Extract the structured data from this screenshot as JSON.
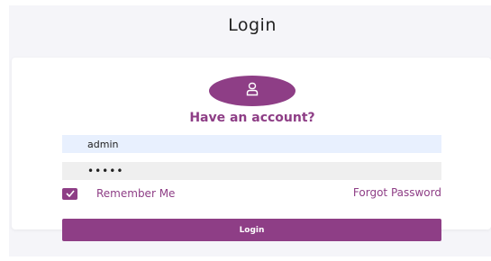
{
  "page": {
    "title": "Login"
  },
  "card": {
    "avatar_icon": "user-icon",
    "heading": "Have an account?",
    "username_value": "admin",
    "password_value": "•••••",
    "remember_label": "Remember Me",
    "remember_checked": true,
    "forgot_label": "Forgot Password",
    "login_label": "Login"
  },
  "colors": {
    "accent": "#8e3e86",
    "username_bg": "#e8f0fe",
    "password_bg": "#efefef",
    "page_bg": "#f5f5f9"
  }
}
